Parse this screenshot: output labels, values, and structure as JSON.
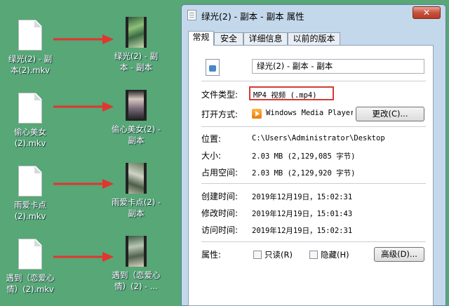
{
  "desktop": {
    "items": [
      {
        "label": "绿光(2) - 副\n本(2).mkv"
      },
      {
        "label": "绿光(2) - 副\n本 - 副本"
      },
      {
        "label": "偷心美女\n(2).mkv"
      },
      {
        "label": "偷心美女(2) -\n副本"
      },
      {
        "label": "雨爱卡点\n(2).mkv"
      },
      {
        "label": "雨爱卡点(2) -\n副本"
      },
      {
        "label": "遇到（恋爱心\n情）(2).mkv"
      },
      {
        "label": "遇到（恋爱心\n情）(2) - ..."
      }
    ]
  },
  "window": {
    "title": "绿光(2) - 副本 - 副本 属性",
    "close": "✕",
    "tabs": [
      {
        "label": "常规"
      },
      {
        "label": "安全"
      },
      {
        "label": "详细信息"
      },
      {
        "label": "以前的版本"
      }
    ],
    "filename": "绿光(2) - 副本 - 副本",
    "file_type_label": "文件类型:",
    "file_type_value": "MP4 视频 (.mp4)",
    "open_with_label": "打开方式:",
    "open_with_value": "Windows Media Player",
    "change_button": "更改(C)...",
    "location_label": "位置:",
    "location_value": "C:\\Users\\Administrator\\Desktop",
    "size_label": "大小:",
    "size_value": "2.03 MB (2,129,085 字节)",
    "size_on_disk_label": "占用空间:",
    "size_on_disk_value": "2.03 MB (2,129,920 字节)",
    "created_label": "创建时间:",
    "created_value": "2019年12月19日，15:02:31",
    "modified_label": "修改时间:",
    "modified_value": "2019年12月19日，15:01:43",
    "accessed_label": "访问时间:",
    "accessed_value": "2019年12月19日，15:02:31",
    "attributes_label": "属性:",
    "readonly_label": "只读(R)",
    "hidden_label": "隐藏(H)",
    "advanced_button": "高级(D)..."
  }
}
